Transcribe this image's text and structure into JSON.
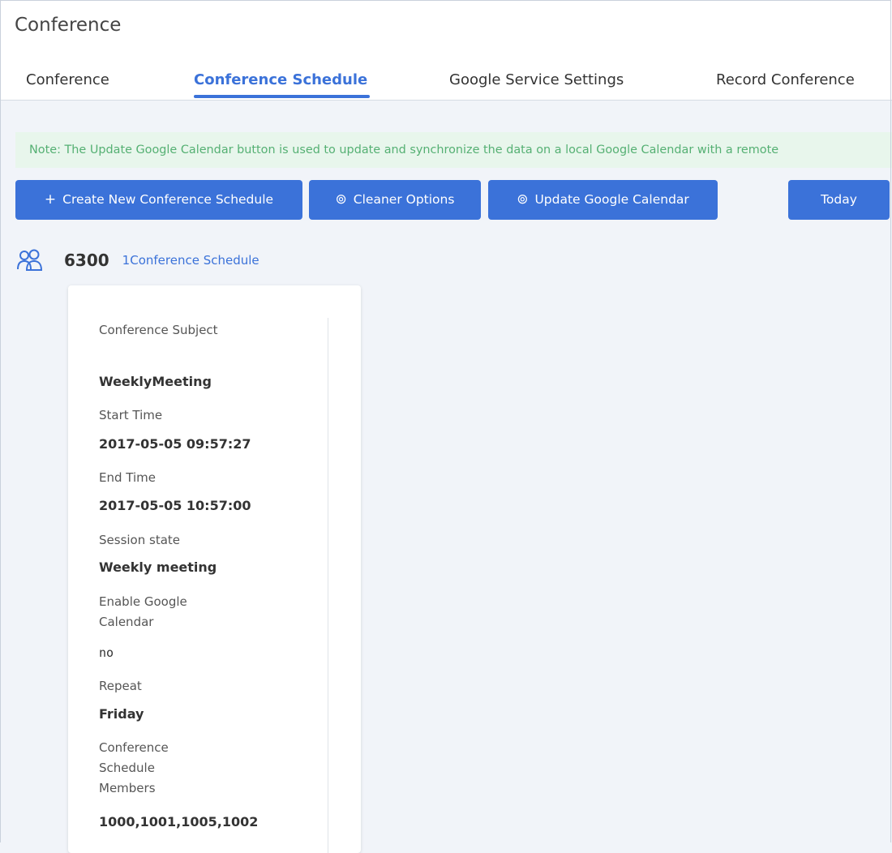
{
  "page": {
    "title": "Conference"
  },
  "tabs": [
    {
      "label": "Conference"
    },
    {
      "label": "Conference Schedule"
    },
    {
      "label": "Google Service Settings"
    },
    {
      "label": "Record Conference"
    }
  ],
  "note": "Note: The Update Google Calendar button is used to update and synchronize the data on a local Google Calendar with a remote",
  "toolbar": {
    "create_icon": "+",
    "create_label": "Create New Conference Schedule",
    "cleaner_label": "Cleaner Options",
    "update_label": "Update Google Calendar",
    "today_label": "Today",
    "settings_icon": "⊚"
  },
  "conference": {
    "icon": "users-icon",
    "number": "6300",
    "count_label": "1Conference Schedule"
  },
  "card": {
    "fields": [
      {
        "label": "Conference Subject",
        "value": "WeeklyMeeting"
      },
      {
        "label": "Start Time",
        "value": "2017-05-05 09:57:27"
      },
      {
        "label": "End Time",
        "value": "2017-05-05 10:57:00"
      },
      {
        "label": "Session state",
        "value": "Weekly meeting"
      },
      {
        "label": "Enable Google Calendar",
        "value": "no"
      },
      {
        "label": "Repeat",
        "value": "Friday"
      },
      {
        "label": "Conference Schedule Members",
        "value": "1000,1001,1005,1002"
      }
    ]
  },
  "colors": {
    "accent": "#3b72d9",
    "note_bg": "#e8f6ec",
    "note_text": "#55b073",
    "page_bg": "#f1f4f9"
  }
}
